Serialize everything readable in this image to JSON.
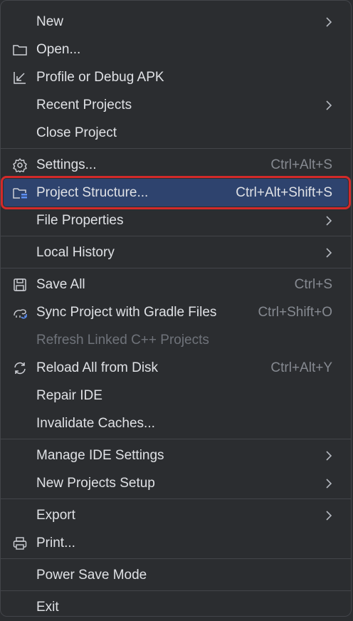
{
  "menu": {
    "items": [
      {
        "label": "New",
        "shortcut": ""
      },
      {
        "label": "Open...",
        "shortcut": ""
      },
      {
        "label": "Profile or Debug APK",
        "shortcut": ""
      },
      {
        "label": "Recent Projects",
        "shortcut": ""
      },
      {
        "label": "Close Project",
        "shortcut": ""
      },
      {
        "label": "Settings...",
        "shortcut": "Ctrl+Alt+S"
      },
      {
        "label": "Project Structure...",
        "shortcut": "Ctrl+Alt+Shift+S"
      },
      {
        "label": "File Properties",
        "shortcut": ""
      },
      {
        "label": "Local History",
        "shortcut": ""
      },
      {
        "label": "Save All",
        "shortcut": "Ctrl+S"
      },
      {
        "label": "Sync Project with Gradle Files",
        "shortcut": "Ctrl+Shift+O"
      },
      {
        "label": "Refresh Linked C++ Projects",
        "shortcut": ""
      },
      {
        "label": "Reload All from Disk",
        "shortcut": "Ctrl+Alt+Y"
      },
      {
        "label": "Repair IDE",
        "shortcut": ""
      },
      {
        "label": "Invalidate Caches...",
        "shortcut": ""
      },
      {
        "label": "Manage IDE Settings",
        "shortcut": ""
      },
      {
        "label": "New Projects Setup",
        "shortcut": ""
      },
      {
        "label": "Export",
        "shortcut": ""
      },
      {
        "label": "Print...",
        "shortcut": ""
      },
      {
        "label": "Power Save Mode",
        "shortcut": ""
      },
      {
        "label": "Exit",
        "shortcut": ""
      }
    ]
  },
  "colors": {
    "background": "#2b2d30",
    "selected_background": "#2e436e",
    "highlight_border": "#d22a2a",
    "text": "#dfe1e5",
    "shortcut_text": "#868a91",
    "disabled_text": "#6f737a"
  }
}
